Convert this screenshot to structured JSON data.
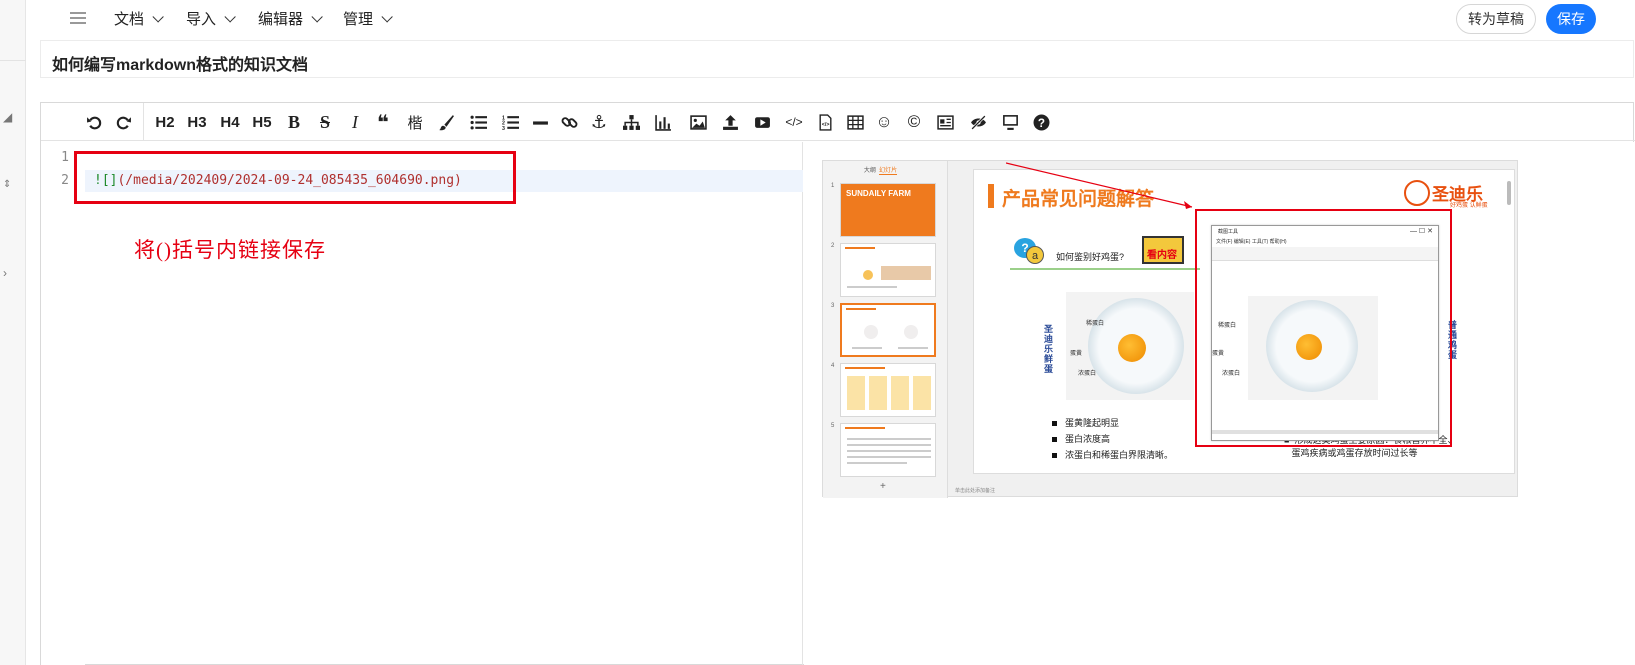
{
  "nav": {
    "menus": [
      "文档",
      "导入",
      "编辑器",
      "管理"
    ],
    "draft_label": "转为草稿",
    "save_label": "保存"
  },
  "doc": {
    "title": "如何编写markdown格式的知识文档"
  },
  "toolbar": {
    "headings": [
      "H2",
      "H3",
      "H4",
      "H5"
    ],
    "kai_label": "楷"
  },
  "editor": {
    "line_numbers": [
      "1",
      "2"
    ],
    "code": {
      "prefix": "![]",
      "url": "(/media/202409/2024-09-24_085435_604690.png)"
    },
    "annotation": "将()括号内链接保存"
  },
  "preview": {
    "thumbs_head": {
      "outline": "大纲",
      "slides": "幻灯片"
    },
    "thumb_numbers": [
      "1",
      "2",
      "3",
      "4",
      "5"
    ],
    "thumb1_title": "SUNDAILY FARM",
    "slide": {
      "title": "产品常见问题解答",
      "brand": "圣迪乐",
      "brand_sub": "好鸡蛋 认鲜蛋",
      "question": "如何鉴别好鸡蛋?",
      "see_label": "看内容",
      "left_label": "圣迪乐鲜蛋",
      "right_label": "普通鸡蛋",
      "egg_labels": [
        "稀蛋白",
        "蛋黄",
        "浓蛋白"
      ],
      "bullets": [
        "蛋黄隆起明显",
        "蛋白浓度高",
        "浓蛋白和稀蛋白界限清晰。"
      ],
      "bullets2": [
        "形成这类鸡蛋主要原因：食粮营养不全、",
        "蛋鸡疾病或鸡蛋存放时间过长等"
      ],
      "snip_title": "截图工具",
      "snip_menu": "文件(F)  编辑(E)  工具(T)  帮助(H)",
      "note": "单击此处添加备注"
    }
  },
  "colors": {
    "accent": "#1677ff",
    "annotation": "#e60012",
    "brand": "#ef7a1e"
  }
}
